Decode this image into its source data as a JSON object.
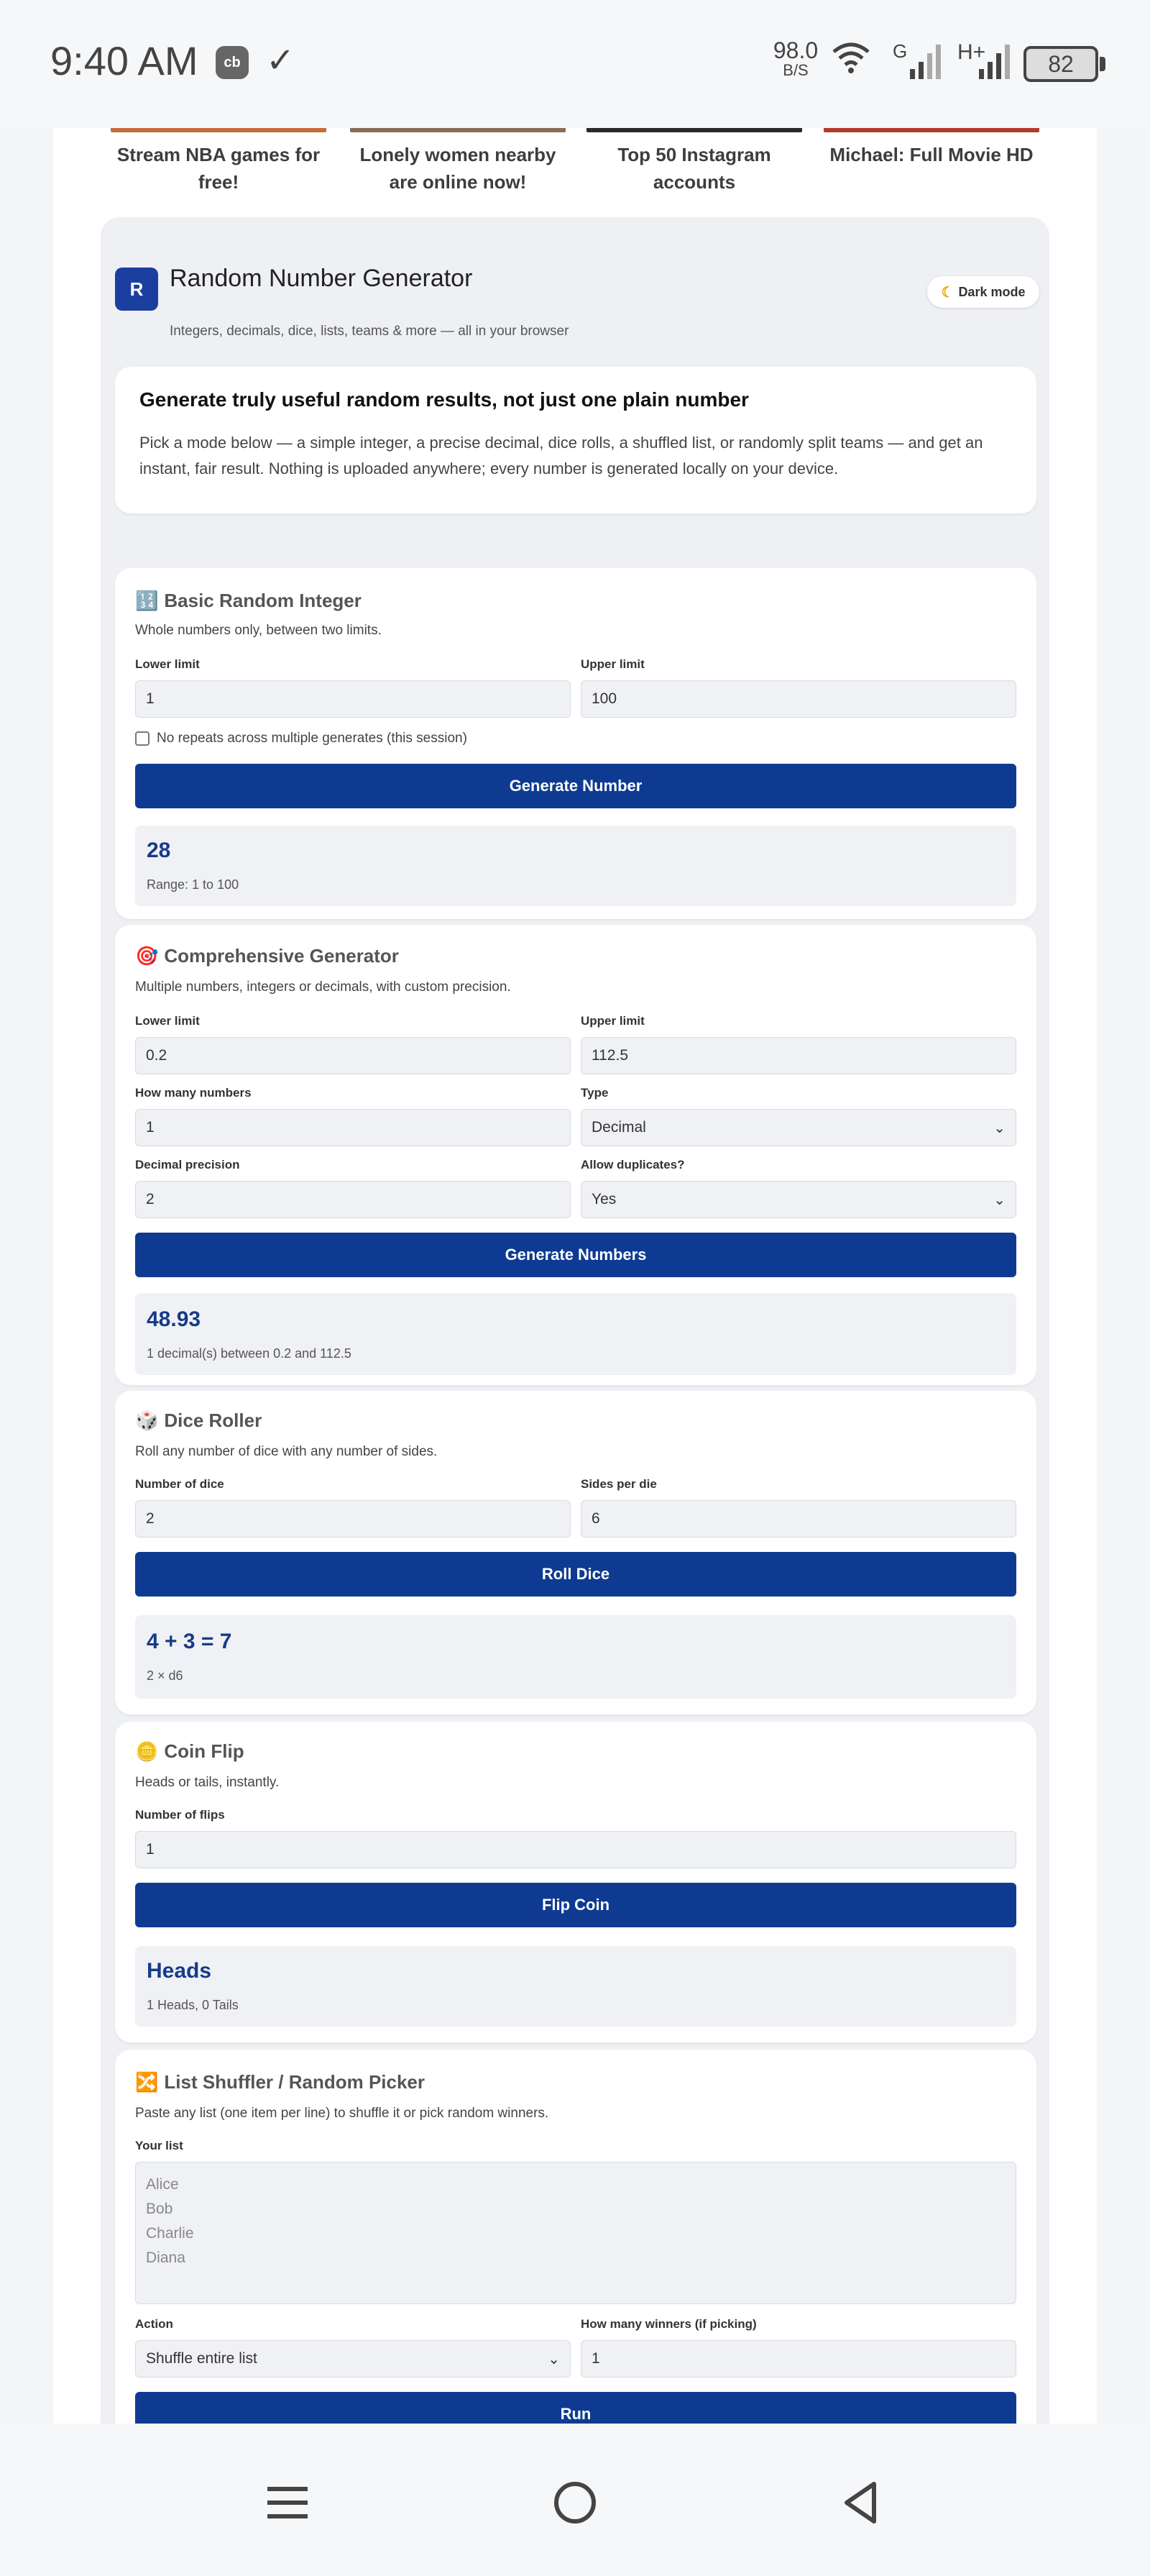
{
  "status_bar": {
    "time": "9:40 AM",
    "app_icon": "cb",
    "net_speed": "98.0",
    "net_speed_unit": "B/S",
    "network_1": "G",
    "network_2": "H+",
    "battery": "82"
  },
  "ads": [
    {
      "text": "Stream NBA games for free!",
      "color": "#c96b3a"
    },
    {
      "text": "Lonely women nearby are online now!",
      "color": "#8b6b55"
    },
    {
      "text": "Top 50 Instagram accounts",
      "color": "#2a2a2a"
    },
    {
      "text": "Michael: Full Movie HD",
      "color": "#b23a2a"
    }
  ],
  "header": {
    "logo_letter": "R",
    "title": "Random Number Generator",
    "subtitle": "Integers, decimals, dice, lists, teams & more — all in your browser",
    "dark_mode_label": "Dark mode"
  },
  "intro": {
    "heading": "Generate truly useful random results, not just one plain number",
    "body": "Pick a mode below — a simple integer, a precise decimal, dice rolls, a shuffled list, or randomly split teams — and get an instant, fair result. Nothing is uploaded anywhere; every number is generated locally on your device."
  },
  "basic": {
    "emoji": "🔢",
    "title": "Basic Random Integer",
    "desc": "Whole numbers only, between two limits.",
    "lower_label": "Lower limit",
    "lower_value": "1",
    "upper_label": "Upper limit",
    "upper_value": "100",
    "no_repeat_label": "No repeats across multiple generates (this session)",
    "button": "Generate Number",
    "result": "28",
    "result_note": "Range: 1 to 100"
  },
  "comprehensive": {
    "emoji": "🎯",
    "title": "Comprehensive Generator",
    "desc": "Multiple numbers, integers or decimals, with custom precision.",
    "lower_label": "Lower limit",
    "lower_value": "0.2",
    "upper_label": "Upper limit",
    "upper_value": "112.5",
    "count_label": "How many numbers",
    "count_value": "1",
    "type_label": "Type",
    "type_value": "Decimal",
    "precision_label": "Decimal precision",
    "precision_value": "2",
    "dupes_label": "Allow duplicates?",
    "dupes_value": "Yes",
    "button": "Generate Numbers",
    "result": "48.93",
    "result_note": "1 decimal(s) between 0.2 and 112.5"
  },
  "dice": {
    "emoji": "🎲",
    "title": "Dice Roller",
    "desc": "Roll any number of dice with any number of sides.",
    "count_label": "Number of dice",
    "count_value": "2",
    "sides_label": "Sides per die",
    "sides_value": "6",
    "button": "Roll Dice",
    "result": "4 + 3 = 7",
    "result_note": "2 × d6"
  },
  "coin": {
    "emoji": "🪙",
    "title": "Coin Flip",
    "desc": "Heads or tails, instantly.",
    "flips_label": "Number of flips",
    "flips_value": "1",
    "button": "Flip Coin",
    "result": "Heads",
    "result_note": "1 Heads, 0 Tails"
  },
  "shuffler": {
    "emoji": "🔀",
    "title": "List Shuffler / Random Picker",
    "desc": "Paste any list (one item per line) to shuffle it or pick random winners.",
    "list_label": "Your list",
    "list_items": [
      "Alice",
      "Bob",
      "Charlie",
      "Diana"
    ],
    "action_label": "Action",
    "action_value": "Shuffle entire list",
    "winners_label": "How many winners (if picking)",
    "winners_value": "1",
    "button": "Run"
  },
  "colors": {
    "primary": "#0e3b91",
    "result_text": "#173b8a",
    "logo_bg": "#1b3f9e"
  }
}
